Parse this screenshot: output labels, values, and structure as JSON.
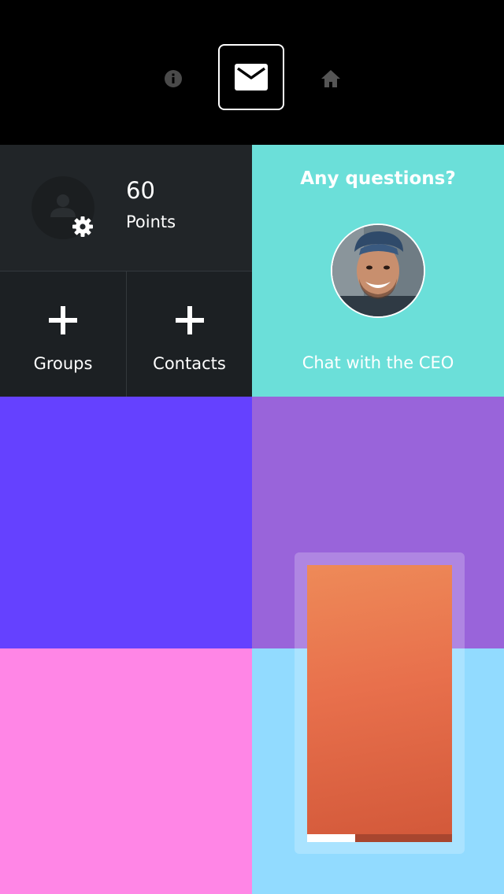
{
  "nav": {
    "icons": [
      "info-icon",
      "mail-icon",
      "home-icon"
    ],
    "active": "mail"
  },
  "profile": {
    "points_value": "60",
    "points_label": "Points"
  },
  "actions": {
    "groups_label": "Groups",
    "contacts_label": "Contacts"
  },
  "ceo": {
    "heading": "Any questions?",
    "link_label": "Chat with the CEO"
  },
  "tiles": {
    "colors": [
      "#6541ff",
      "#9964da",
      "#ff86e6",
      "#92dbff"
    ]
  },
  "story": {
    "progress": 0.33,
    "colors": {
      "image_top": "#ee8a58",
      "image_bottom": "#d3593a",
      "track": "#a8462f"
    }
  },
  "colors": {
    "background": "#000000",
    "profile_bg": "#212528",
    "ceo_bg": "#6bdfd9"
  }
}
